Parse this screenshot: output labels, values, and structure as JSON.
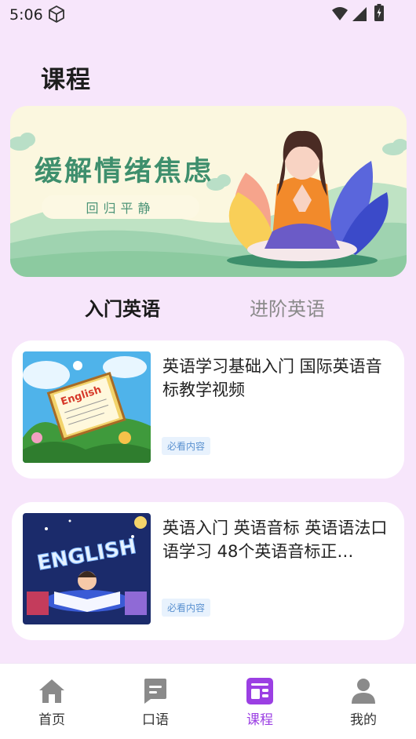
{
  "status_bar": {
    "time": "5:06"
  },
  "header": {
    "title": "课程"
  },
  "banner": {
    "title": "缓解情绪焦虑",
    "subtitle": "回归平静"
  },
  "tabs": [
    {
      "label": "入门英语",
      "active": true
    },
    {
      "label": "进阶英语",
      "active": false
    }
  ],
  "courses": [
    {
      "title": "英语学习基础入门 国际英语音标教学视频",
      "badge": "必看内容"
    },
    {
      "title": "英语入门 英语音标 英语语法口语学习 48个英语音标正…",
      "badge": "必看内容"
    }
  ],
  "bottom_nav": [
    {
      "label": "首页",
      "icon": "home-icon",
      "active": false
    },
    {
      "label": "口语",
      "icon": "speech-icon",
      "active": false
    },
    {
      "label": "课程",
      "icon": "course-icon",
      "active": true
    },
    {
      "label": "我的",
      "icon": "profile-icon",
      "active": false
    }
  ],
  "colors": {
    "accent": "#9b3fe3",
    "background": "#f7e6fb",
    "banner_text": "#3e8f6d",
    "badge_text": "#5a91d0"
  }
}
